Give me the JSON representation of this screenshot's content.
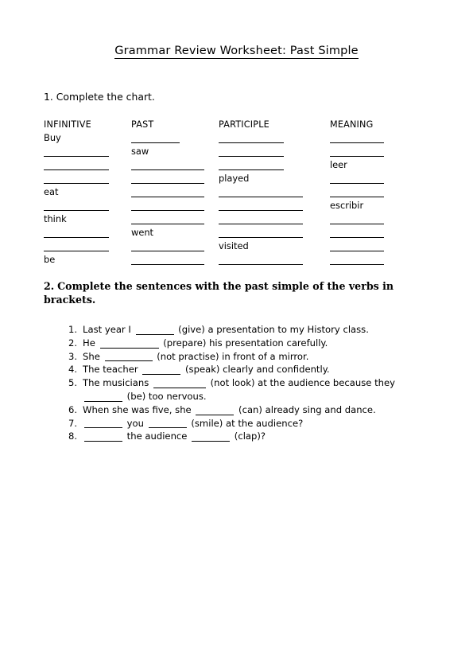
{
  "document": {
    "title": "Grammar Review Worksheet: Past Simple"
  },
  "exercise1": {
    "heading": "1. Complete the chart.",
    "columns": [
      {
        "header": "INFINITIVE",
        "cells": [
          {
            "type": "word",
            "text": "Buy"
          },
          {
            "type": "blank",
            "text": ""
          },
          {
            "type": "blank",
            "text": ""
          },
          {
            "type": "blank",
            "text": ""
          },
          {
            "type": "word",
            "text": "eat"
          },
          {
            "type": "blank",
            "text": ""
          },
          {
            "type": "word",
            "text": "think"
          },
          {
            "type": "blank",
            "text": ""
          },
          {
            "type": "blank",
            "text": ""
          },
          {
            "type": "word",
            "text": "be"
          }
        ]
      },
      {
        "header": "PAST",
        "cells": [
          {
            "type": "blank",
            "text": "",
            "width": "short"
          },
          {
            "type": "word",
            "text": "saw"
          },
          {
            "type": "blank",
            "text": ""
          },
          {
            "type": "blank",
            "text": ""
          },
          {
            "type": "blank",
            "text": ""
          },
          {
            "type": "blank",
            "text": ""
          },
          {
            "type": "blank",
            "text": ""
          },
          {
            "type": "word",
            "text": "went"
          },
          {
            "type": "blank",
            "text": ""
          },
          {
            "type": "blank",
            "text": ""
          }
        ]
      },
      {
        "header": "PARTICIPLE",
        "cells": [
          {
            "type": "blank",
            "text": "",
            "width": "short"
          },
          {
            "type": "blank",
            "text": "",
            "width": "short"
          },
          {
            "type": "blank",
            "text": "",
            "width": "short"
          },
          {
            "type": "word",
            "text": "played"
          },
          {
            "type": "blank",
            "text": ""
          },
          {
            "type": "blank",
            "text": ""
          },
          {
            "type": "blank",
            "text": ""
          },
          {
            "type": "blank",
            "text": ""
          },
          {
            "type": "word",
            "text": "visited"
          },
          {
            "type": "blank",
            "text": ""
          }
        ]
      },
      {
        "header": "MEANING",
        "cells": [
          {
            "type": "blank",
            "text": ""
          },
          {
            "type": "blank",
            "text": ""
          },
          {
            "type": "word",
            "text": "leer"
          },
          {
            "type": "blank",
            "text": ""
          },
          {
            "type": "blank",
            "text": ""
          },
          {
            "type": "word",
            "text": "escribir"
          },
          {
            "type": "blank",
            "text": ""
          },
          {
            "type": "blank",
            "text": ""
          },
          {
            "type": "blank",
            "text": ""
          },
          {
            "type": "blank",
            "text": ""
          }
        ]
      }
    ]
  },
  "exercise2": {
    "number": "2.",
    "heading": "Complete the sentences with the past simple of the verbs in brackets.",
    "items": [
      {
        "number": "1.",
        "parts": [
          {
            "t": "text",
            "v": "Last year I "
          },
          {
            "t": "blank",
            "w": "w1"
          },
          {
            "t": "text",
            "v": " (give) a presentation to my History class."
          }
        ]
      },
      {
        "number": "2.",
        "parts": [
          {
            "t": "text",
            "v": "He "
          },
          {
            "t": "blank",
            "w": "w2"
          },
          {
            "t": "text",
            "v": " (prepare) his presentation carefully."
          }
        ]
      },
      {
        "number": "3.",
        "parts": [
          {
            "t": "text",
            "v": "She "
          },
          {
            "t": "blank",
            "w": "w3"
          },
          {
            "t": "text",
            "v": " (not practise) in front of a mirror."
          }
        ]
      },
      {
        "number": "4.",
        "parts": [
          {
            "t": "text",
            "v": "The teacher "
          },
          {
            "t": "blank",
            "w": "w1"
          },
          {
            "t": "text",
            "v": " (speak) clearly and confidently."
          }
        ]
      },
      {
        "number": "5.",
        "parts": [
          {
            "t": "text",
            "v": "The musicians "
          },
          {
            "t": "blank",
            "w": "w4"
          },
          {
            "t": "text",
            "v": " (not look) at the audience because they "
          },
          {
            "t": "blank",
            "w": "w1"
          },
          {
            "t": "text",
            "v": " (be) too nervous."
          }
        ]
      },
      {
        "number": "6.",
        "parts": [
          {
            "t": "text",
            "v": "When she was five, she "
          },
          {
            "t": "blank",
            "w": "w1"
          },
          {
            "t": "text",
            "v": " (can) already sing and dance."
          }
        ]
      },
      {
        "number": "7.",
        "parts": [
          {
            "t": "blank",
            "w": "w1"
          },
          {
            "t": "text",
            "v": " you "
          },
          {
            "t": "blank",
            "w": "w1"
          },
          {
            "t": "text",
            "v": " (smile) at the audience?"
          }
        ]
      },
      {
        "number": "8.",
        "parts": [
          {
            "t": "blank",
            "w": "w1"
          },
          {
            "t": "text",
            "v": " the audience "
          },
          {
            "t": "blank",
            "w": "w1"
          },
          {
            "t": "text",
            "v": " (clap)?"
          }
        ]
      }
    ]
  }
}
